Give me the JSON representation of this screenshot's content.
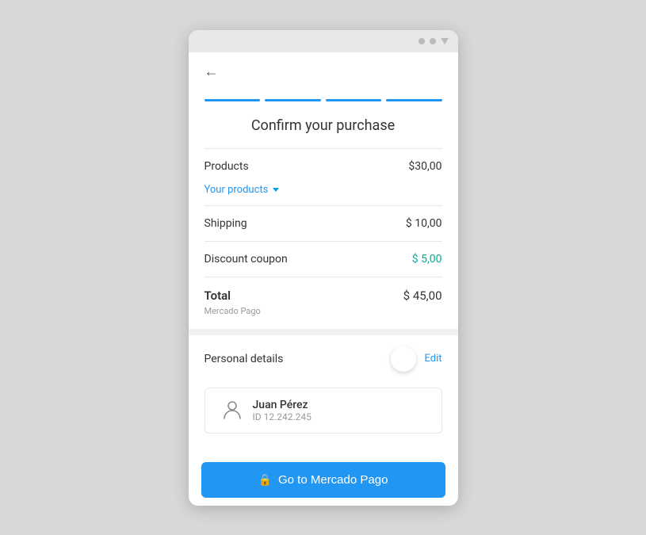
{
  "statusBar": {
    "dots": [
      "dot1",
      "dot2"
    ],
    "triangle": "signal"
  },
  "nav": {
    "backArrow": "←"
  },
  "progressBar": {
    "segments": 4
  },
  "page": {
    "title": "Confirm your purchase"
  },
  "orderSummary": {
    "products": {
      "label": "Products",
      "value": "$30,00"
    },
    "yourProducts": {
      "label": "Your products"
    },
    "shipping": {
      "label": "Shipping",
      "value": "$ 10,00"
    },
    "discountCoupon": {
      "label": "Discount coupon",
      "value": "$ 5,00"
    },
    "total": {
      "label": "Total",
      "value": "$ 45,00",
      "subLabel": "Mercado Pago"
    }
  },
  "personalDetails": {
    "label": "Personal details",
    "editLabel": "Edit",
    "user": {
      "name": "Juan Pérez",
      "id": "ID 12.242.245"
    }
  },
  "cta": {
    "label": "Go to Mercado Pago",
    "lockIcon": "🔒"
  }
}
